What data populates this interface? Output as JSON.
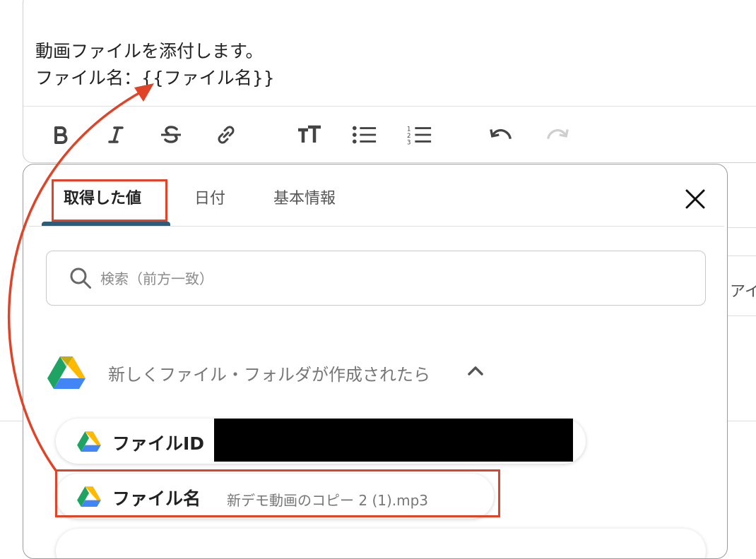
{
  "editor": {
    "line1": "動画ファイルを添付します。",
    "line2": "ファイル名：{{ファイル名}}",
    "toolbar_icons": [
      "bold-icon",
      "italic-icon",
      "strikethrough-icon",
      "link-icon",
      "text-size-icon",
      "bullet-list-icon",
      "numbered-list-icon",
      "undo-icon",
      "redo-icon"
    ]
  },
  "background_field_text": "アイ",
  "popup": {
    "tabs": [
      {
        "label": "取得した値",
        "active": true
      },
      {
        "label": "日付",
        "active": false
      },
      {
        "label": "基本情報",
        "active": false
      }
    ],
    "close_icon": "close-icon",
    "search": {
      "placeholder": "検索（前方一致）",
      "value": ""
    },
    "section": {
      "title": "新しくファイル・フォルダが作成されたら",
      "expanded": true
    },
    "items": [
      {
        "label": "ファイルID",
        "value": "",
        "redacted": true
      },
      {
        "label": "ファイル名",
        "value": "新デモ動画のコピー 2 (1).mp3",
        "highlighted": true
      }
    ]
  },
  "colors": {
    "highlight": "#e04428",
    "tab_underline": "#2b5d7a",
    "drive_green": "#1ea362",
    "drive_blue": "#4285f4",
    "drive_yellow": "#ffba00"
  }
}
